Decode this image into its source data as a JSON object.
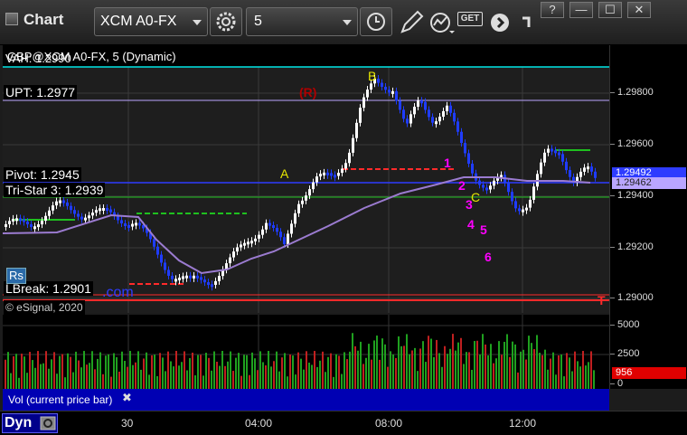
{
  "toolbar": {
    "title": "Chart",
    "symbol": "XCM A0-FX",
    "interval": "5",
    "get_label": "GET",
    "window_buttons": [
      "?",
      "—",
      "☐",
      "✕"
    ]
  },
  "chart": {
    "header": "GBP@XCM A0-FX, 5 (Dynamic)",
    "header_overlap": "VAH: 1.2990",
    "levels": {
      "upt": "UPT: 1.2977",
      "pivot": "Pivot: 1.2945",
      "tristar": "Tri-Star 3: 1.2939",
      "lbreak": "LBreak: 1.2901"
    },
    "copyright": "© eSignal, 2020",
    "watermark": ".com",
    "badge": "Rs",
    "annotations": {
      "r": "(R)",
      "b": "B",
      "a": "A",
      "c": "C",
      "seq": [
        "1",
        "2",
        "3",
        "4",
        "5",
        "6"
      ],
      "t": "T"
    },
    "y_ticks": [
      "1.29800",
      "1.29600",
      "1.29400",
      "1.29200",
      "1.29000"
    ],
    "last_price": "1.29492",
    "avg_price": "1.29462"
  },
  "volume": {
    "legend": "Vol (current price bar)",
    "close": "✖",
    "y_ticks": [
      "5000",
      "2500",
      "0"
    ],
    "last_volume": "956"
  },
  "time_axis": {
    "labels": [
      "30",
      "04:00",
      "08:00",
      "12:00"
    ],
    "dyn": "Dyn"
  },
  "colors": {
    "up": "#ffffff",
    "down": "#1f3cff",
    "avg_line": "#9b7bd0",
    "pivot_line": "#2e3cff",
    "upt_line": "#b9a6ff",
    "vah_line": "#00e5e5",
    "red_level": "#ff2a2a",
    "green_level": "#1fc01f",
    "magenta": "#ff00ff",
    "yellow": "#e6e600"
  }
}
